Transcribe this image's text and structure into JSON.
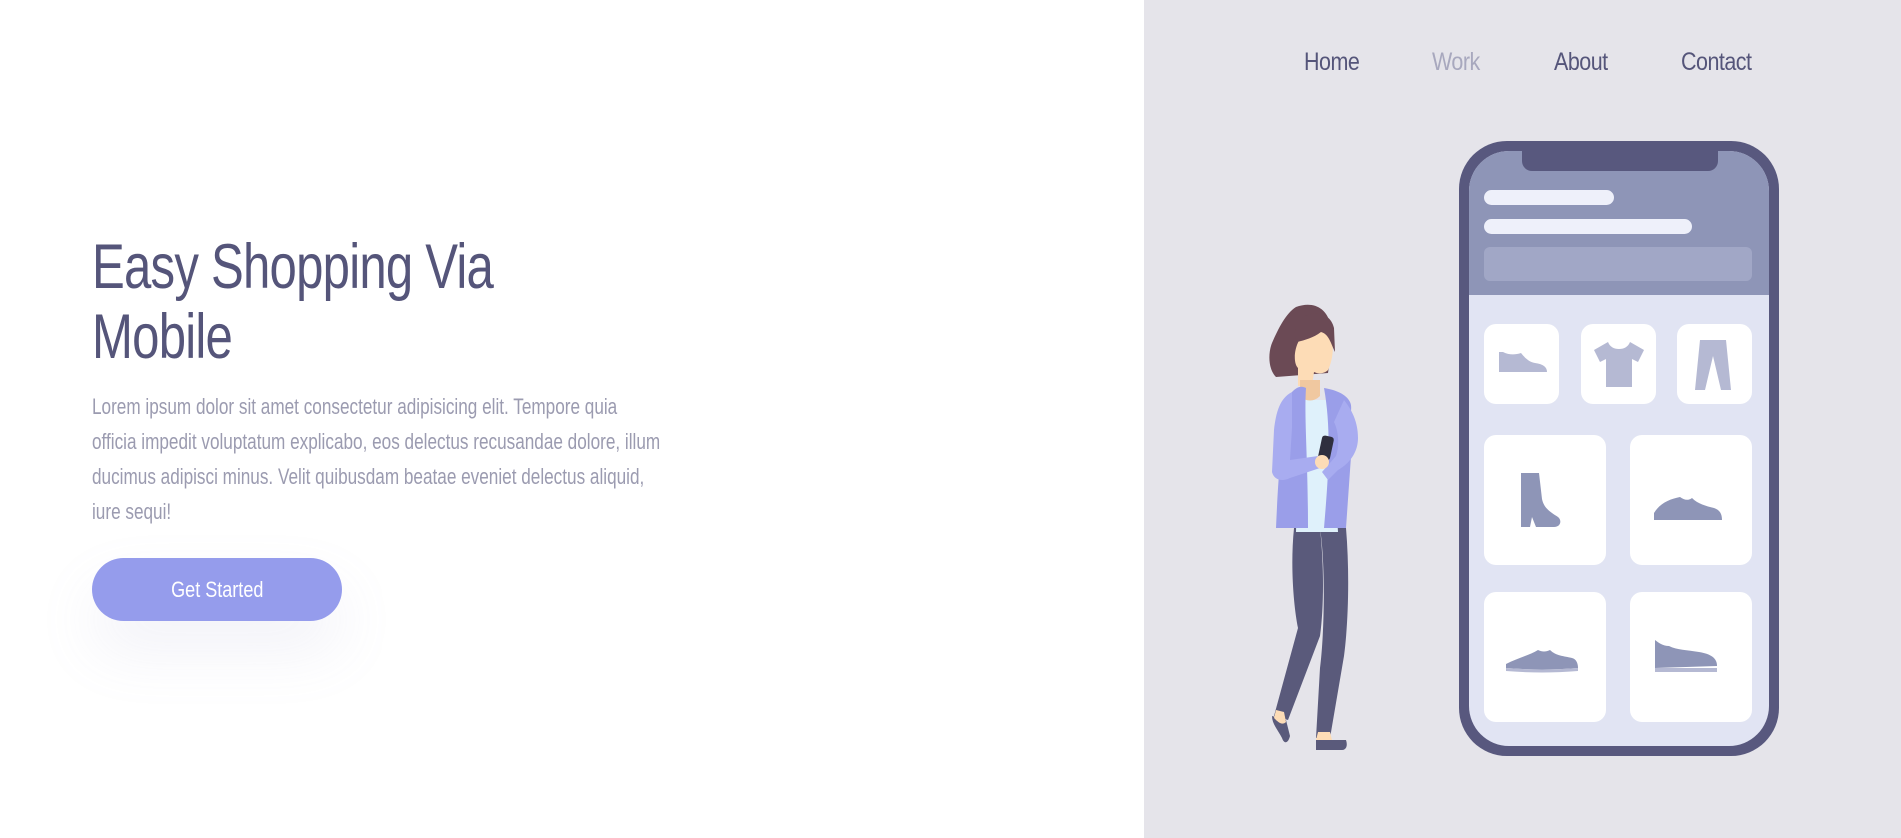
{
  "nav": {
    "items": [
      {
        "label": "Home",
        "active": false
      },
      {
        "label": "Work",
        "active": true
      },
      {
        "label": "About",
        "active": false
      },
      {
        "label": "Contact",
        "active": false
      }
    ]
  },
  "hero": {
    "title_line1": "Easy Shopping Via",
    "title_line2": "Mobile",
    "description": "Lorem ipsum dolor sit amet consectetur adipisicing elit. Tempore quia officia impedit voluptatum explicabo, eos delectus recusandae dolore, illum ducimus adipisci minus. Velit quibusdam beatae eveniet delectus aliquid, iure sequi!",
    "cta_label": "Get Started"
  },
  "colors": {
    "accent": "#959cec",
    "text_primary": "#55557a",
    "text_muted": "#9b9bb0",
    "nav_active": "#a8a8be",
    "panel_bg": "#e5e4ea",
    "phone_frame": "#58587e"
  },
  "illustration": {
    "products": [
      "shoe-icon",
      "tshirt-icon",
      "pants-icon",
      "boot-icon",
      "sneaker-icon",
      "sneaker-icon",
      "sneaker-icon"
    ]
  }
}
